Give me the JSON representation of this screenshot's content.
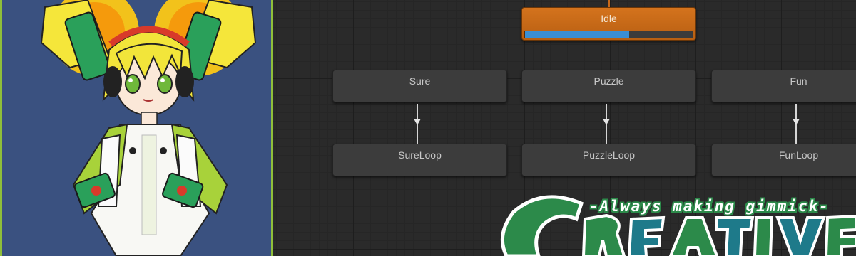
{
  "preview": {
    "character": "anime-girl-mascot",
    "bg_color": "#3a5180",
    "border_color": "#8fbf3a"
  },
  "graph": {
    "nodes": {
      "idle": {
        "label": "Idle",
        "is_default": true,
        "progress_percent": 62
      },
      "sure": {
        "label": "Sure"
      },
      "puzzle": {
        "label": "Puzzle"
      },
      "fun": {
        "label": "Fun"
      },
      "sure_loop": {
        "label": "SureLoop"
      },
      "puzzle_loop": {
        "label": "PuzzleLoop"
      },
      "fun_loop": {
        "label": "FunLoop"
      }
    },
    "transitions": [
      {
        "from": "Sure",
        "to": "SureLoop"
      },
      {
        "from": "Puzzle",
        "to": "PuzzleLoop"
      },
      {
        "from": "Fun",
        "to": "FunLoop"
      }
    ],
    "colors": {
      "default_node": "#c8691a",
      "progress": "#3a8ed4",
      "node": "#3c3c3c"
    }
  },
  "logo": {
    "tagline": "-Always making gimmick-",
    "wordmark": "CREATIVE",
    "colors": {
      "green": "#2c8a4a",
      "teal": "#1e7a8a",
      "white": "#ffffff"
    }
  }
}
